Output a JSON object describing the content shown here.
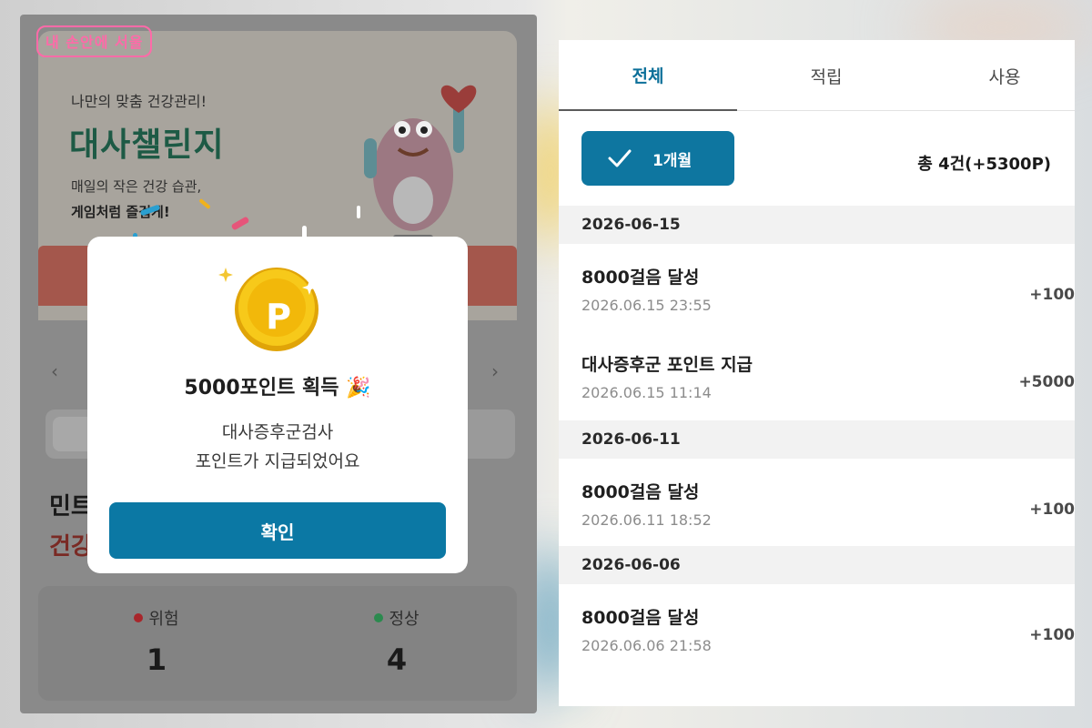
{
  "overlay_logo": "내 손안에 서울",
  "left_screen": {
    "banner": {
      "kicker": "나만의 맞춤 건강관리!",
      "title": "대사챌린지",
      "desc_line1": "매일의 작은 건강 습관,",
      "desc_line2": "게임처럼 즐겁게!"
    },
    "section_title": "민트",
    "section_sub": "건강",
    "stats": {
      "risk": {
        "label": "위험",
        "value": "1",
        "color": "#a8262b"
      },
      "normal": {
        "label": "정상",
        "value": "4",
        "color": "#2b8a4e"
      }
    },
    "modal": {
      "coin_letter": "P",
      "title": "5000포인트 획득 🎉",
      "message_line1": "대사증후군검사",
      "message_line2": "포인트가 지급되었어요",
      "confirm_label": "확인"
    }
  },
  "right_screen": {
    "tabs": [
      {
        "label": "전체",
        "active": true
      },
      {
        "label": "적립",
        "active": false
      },
      {
        "label": "사용",
        "active": false
      }
    ],
    "period_button": "1개월",
    "total_summary": "총 4건(+5300P)",
    "groups": [
      {
        "date": "2026-06-15",
        "entries": [
          {
            "title": "8000걸음 달성",
            "time": "2026.06.15 23:55",
            "points": "+100"
          },
          {
            "title": "대사증후군 포인트 지급",
            "time": "2026.06.15 11:14",
            "points": "+5000"
          }
        ]
      },
      {
        "date": "2026-06-11",
        "entries": [
          {
            "title": "8000걸음 달성",
            "time": "2026.06.11 18:52",
            "points": "+100"
          }
        ]
      },
      {
        "date": "2026-06-06",
        "entries": [
          {
            "title": "8000걸음 달성",
            "time": "2026.06.06 21:58",
            "points": "+100"
          }
        ]
      }
    ],
    "accent_color": "#0e76a0"
  }
}
